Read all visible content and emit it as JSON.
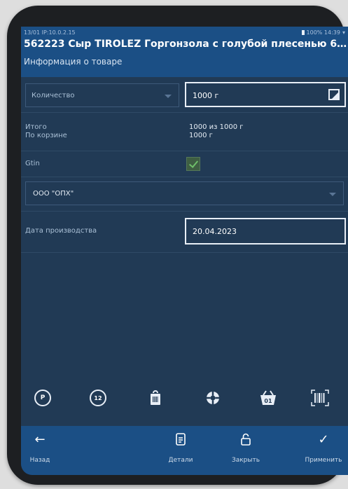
{
  "status": {
    "left": "13/01 IP:10.0.2.15",
    "right": "100% 14:39"
  },
  "header": {
    "title": "562223 Сыр TIROLEZ Горгонзола с голубой плесенью 6...",
    "subtitle": "Информация о товаре"
  },
  "quantity": {
    "label": "Количество",
    "value": "1000 г",
    "unit_icon": "unit-toggle-icon"
  },
  "totals": {
    "itogo_label": "Итого",
    "basket_label": "По корзине",
    "itogo_value": "1000 из 1000 г",
    "basket_value": "1000 г"
  },
  "gtin": {
    "label": "Gtin",
    "checked": true
  },
  "organization": {
    "value": "ООО \"ОПХ\""
  },
  "production_date": {
    "label": "Дата производства",
    "value": "20.04.2023"
  },
  "toolbar": [
    {
      "name": "p-icon",
      "text": "P"
    },
    {
      "name": "12-icon",
      "text": "12"
    },
    {
      "name": "bag-barcode-icon"
    },
    {
      "name": "lifebuoy-icon"
    },
    {
      "name": "basket-01-icon",
      "text": "01"
    },
    {
      "name": "barcode-scan-icon"
    }
  ],
  "bottom_nav": {
    "back": {
      "label": "Назад",
      "icon": "arrow-left-icon"
    },
    "details": {
      "label": "Детали",
      "icon": "document-icon"
    },
    "close": {
      "label": "Закрыть",
      "icon": "lock-icon"
    },
    "apply": {
      "label": "Применить",
      "icon": "checkmark-icon"
    }
  },
  "colors": {
    "header": "#1b4f85",
    "background": "#213a55",
    "accent_check": "#6fbf6a"
  }
}
